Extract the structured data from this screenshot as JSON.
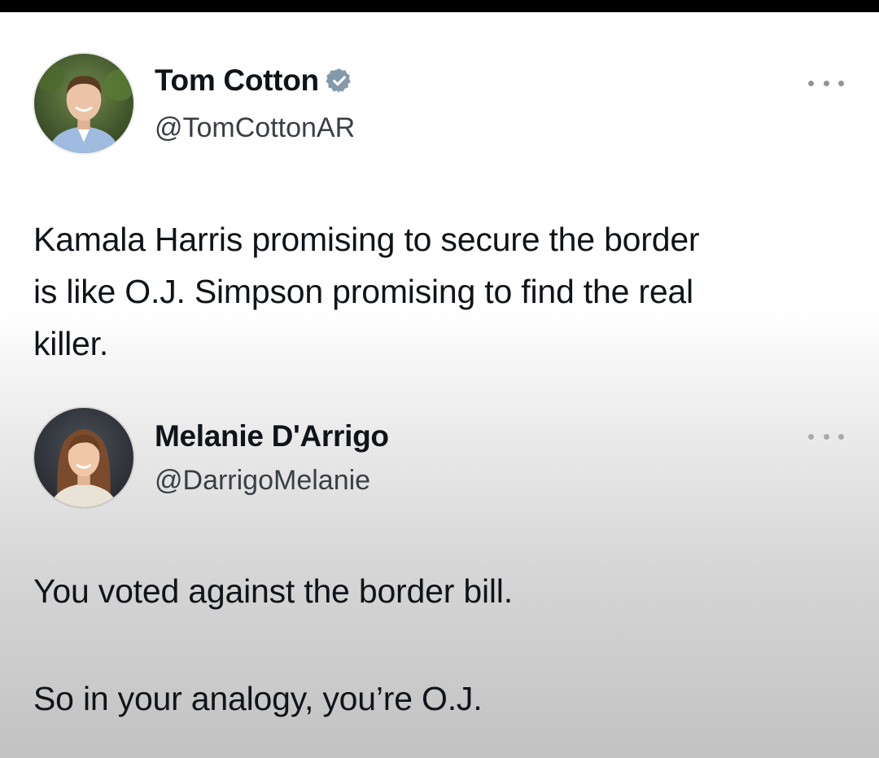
{
  "tweets": [
    {
      "author": {
        "display_name": "Tom Cotton",
        "handle": "@TomCottonAR",
        "verified": true
      },
      "text": "Kamala Harris promising to secure the border\nis like O.J. Simpson promising to find the real\nkiller."
    },
    {
      "author": {
        "display_name": "Melanie D'Arrigo",
        "handle": "@DarrigoMelanie",
        "verified": false
      },
      "paragraphs": [
        "You voted against the border bill.",
        "So in your analogy, you’re O.J."
      ]
    }
  ],
  "colors": {
    "verified_badge": "#829aab",
    "text": "#0f1419",
    "handle": "#3a3f45"
  }
}
